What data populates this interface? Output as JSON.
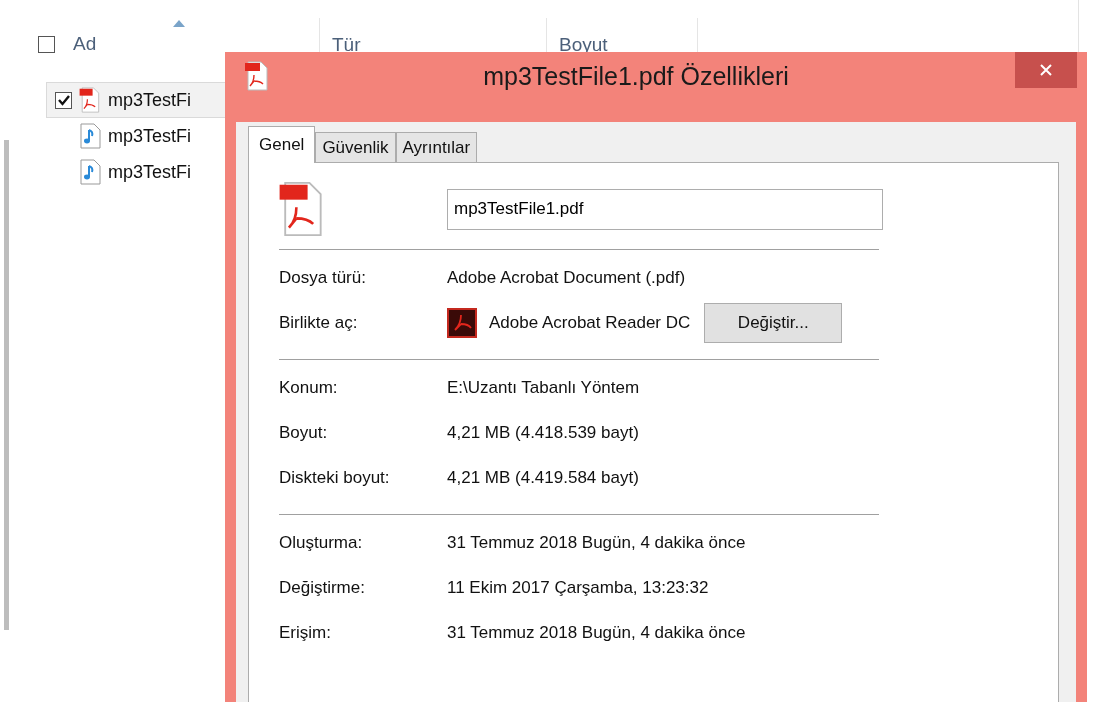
{
  "explorer": {
    "select_all_checked": false,
    "columns": [
      {
        "label": "Ad",
        "sorted": true
      },
      {
        "label": "Tür"
      },
      {
        "label": "Boyut"
      }
    ],
    "files": [
      {
        "name": "mp3TestFi",
        "kind": "pdf",
        "checked": true,
        "selected": true
      },
      {
        "name": "mp3TestFi",
        "kind": "audio",
        "checked": false,
        "selected": false
      },
      {
        "name": "mp3TestFi",
        "kind": "audio",
        "checked": false,
        "selected": false
      }
    ]
  },
  "dialog": {
    "title": "mp3TestFile1.pdf Özellikleri",
    "tabs": [
      {
        "label": "Genel",
        "selected": true
      },
      {
        "label": "Güvenlik",
        "selected": false
      },
      {
        "label": "Ayrıntılar",
        "selected": false
      }
    ],
    "file_name": "mp3TestFile1.pdf",
    "sections": [
      [
        {
          "kind": "text",
          "label": "Dosya türü:",
          "value": "Adobe Acrobat Document (.pdf)"
        },
        {
          "kind": "app",
          "label": "Birlikte aç:",
          "value": "Adobe Acrobat Reader DC",
          "button": "Değiştir..."
        }
      ],
      [
        {
          "kind": "text",
          "label": "Konum:",
          "value": "E:\\Uzantı Tabanlı Yöntem"
        },
        {
          "kind": "text",
          "label": "Boyut:",
          "value": "4,21 MB (4.418.539 bayt)"
        },
        {
          "kind": "text",
          "label": "Diskteki boyut:",
          "value": "4,21 MB (4.419.584 bayt)"
        }
      ],
      [
        {
          "kind": "text",
          "label": "Oluşturma:",
          "value": "31 Temmuz 2018 Bugün, 4 dakika önce"
        },
        {
          "kind": "text",
          "label": "Değiştirme:",
          "value": "11 Ekim 2017 Çarşamba, 13:23:32"
        },
        {
          "kind": "text",
          "label": "Erişim:",
          "value": "31 Temmuz 2018 Bugün, 4 dakika önce"
        }
      ]
    ]
  }
}
